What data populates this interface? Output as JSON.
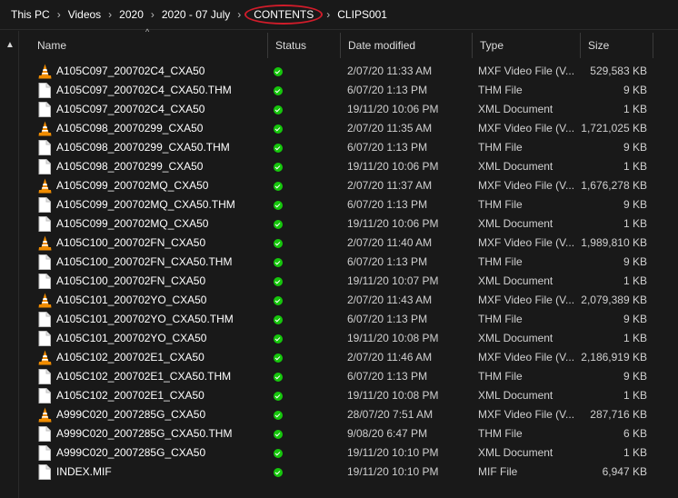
{
  "breadcrumb": [
    "This PC",
    "Videos",
    "2020",
    "2020 - 07 July",
    "CONTENTS",
    "CLIPS001"
  ],
  "colors": {
    "accent_circle": "#d01c2a",
    "status_green": "#16c60c",
    "vlc_orange": "#f08c00"
  },
  "columns": {
    "name": "Name",
    "status": "Status",
    "date": "Date modified",
    "type": "Type",
    "size": "Size"
  },
  "files": [
    {
      "name": "A105C097_200702C4_CXA50",
      "date": "2/07/20 11:33 AM",
      "type": "MXF Video File (V...",
      "size": "529,583 KB",
      "icon": "vlc-cone-icon"
    },
    {
      "name": "A105C097_200702C4_CXA50.THM",
      "date": "6/07/20 1:13 PM",
      "type": "THM File",
      "size": "9 KB",
      "icon": "file-icon"
    },
    {
      "name": "A105C097_200702C4_CXA50",
      "date": "19/11/20 10:06 PM",
      "type": "XML Document",
      "size": "1 KB",
      "icon": "file-icon"
    },
    {
      "name": "A105C098_20070299_CXA50",
      "date": "2/07/20 11:35 AM",
      "type": "MXF Video File (V...",
      "size": "1,721,025 KB",
      "icon": "vlc-cone-icon"
    },
    {
      "name": "A105C098_20070299_CXA50.THM",
      "date": "6/07/20 1:13 PM",
      "type": "THM File",
      "size": "9 KB",
      "icon": "file-icon"
    },
    {
      "name": "A105C098_20070299_CXA50",
      "date": "19/11/20 10:06 PM",
      "type": "XML Document",
      "size": "1 KB",
      "icon": "file-icon"
    },
    {
      "name": "A105C099_200702MQ_CXA50",
      "date": "2/07/20 11:37 AM",
      "type": "MXF Video File (V...",
      "size": "1,676,278 KB",
      "icon": "vlc-cone-icon"
    },
    {
      "name": "A105C099_200702MQ_CXA50.THM",
      "date": "6/07/20 1:13 PM",
      "type": "THM File",
      "size": "9 KB",
      "icon": "file-icon"
    },
    {
      "name": "A105C099_200702MQ_CXA50",
      "date": "19/11/20 10:06 PM",
      "type": "XML Document",
      "size": "1 KB",
      "icon": "file-icon"
    },
    {
      "name": "A105C100_200702FN_CXA50",
      "date": "2/07/20 11:40 AM",
      "type": "MXF Video File (V...",
      "size": "1,989,810 KB",
      "icon": "vlc-cone-icon"
    },
    {
      "name": "A105C100_200702FN_CXA50.THM",
      "date": "6/07/20 1:13 PM",
      "type": "THM File",
      "size": "9 KB",
      "icon": "file-icon"
    },
    {
      "name": "A105C100_200702FN_CXA50",
      "date": "19/11/20 10:07 PM",
      "type": "XML Document",
      "size": "1 KB",
      "icon": "file-icon"
    },
    {
      "name": "A105C101_200702YO_CXA50",
      "date": "2/07/20 11:43 AM",
      "type": "MXF Video File (V...",
      "size": "2,079,389 KB",
      "icon": "vlc-cone-icon"
    },
    {
      "name": "A105C101_200702YO_CXA50.THM",
      "date": "6/07/20 1:13 PM",
      "type": "THM File",
      "size": "9 KB",
      "icon": "file-icon"
    },
    {
      "name": "A105C101_200702YO_CXA50",
      "date": "19/11/20 10:08 PM",
      "type": "XML Document",
      "size": "1 KB",
      "icon": "file-icon"
    },
    {
      "name": "A105C102_200702E1_CXA50",
      "date": "2/07/20 11:46 AM",
      "type": "MXF Video File (V...",
      "size": "2,186,919 KB",
      "icon": "vlc-cone-icon"
    },
    {
      "name": "A105C102_200702E1_CXA50.THM",
      "date": "6/07/20 1:13 PM",
      "type": "THM File",
      "size": "9 KB",
      "icon": "file-icon"
    },
    {
      "name": "A105C102_200702E1_CXA50",
      "date": "19/11/20 10:08 PM",
      "type": "XML Document",
      "size": "1 KB",
      "icon": "file-icon"
    },
    {
      "name": "A999C020_2007285G_CXA50",
      "date": "28/07/20 7:51 AM",
      "type": "MXF Video File (V...",
      "size": "287,716 KB",
      "icon": "vlc-cone-icon"
    },
    {
      "name": "A999C020_2007285G_CXA50.THM",
      "date": "9/08/20 6:47 PM",
      "type": "THM File",
      "size": "6 KB",
      "icon": "file-icon"
    },
    {
      "name": "A999C020_2007285G_CXA50",
      "date": "19/11/20 10:10 PM",
      "type": "XML Document",
      "size": "1 KB",
      "icon": "file-icon"
    },
    {
      "name": "INDEX.MIF",
      "date": "19/11/20 10:10 PM",
      "type": "MIF File",
      "size": "6,947 KB",
      "icon": "file-icon"
    }
  ]
}
